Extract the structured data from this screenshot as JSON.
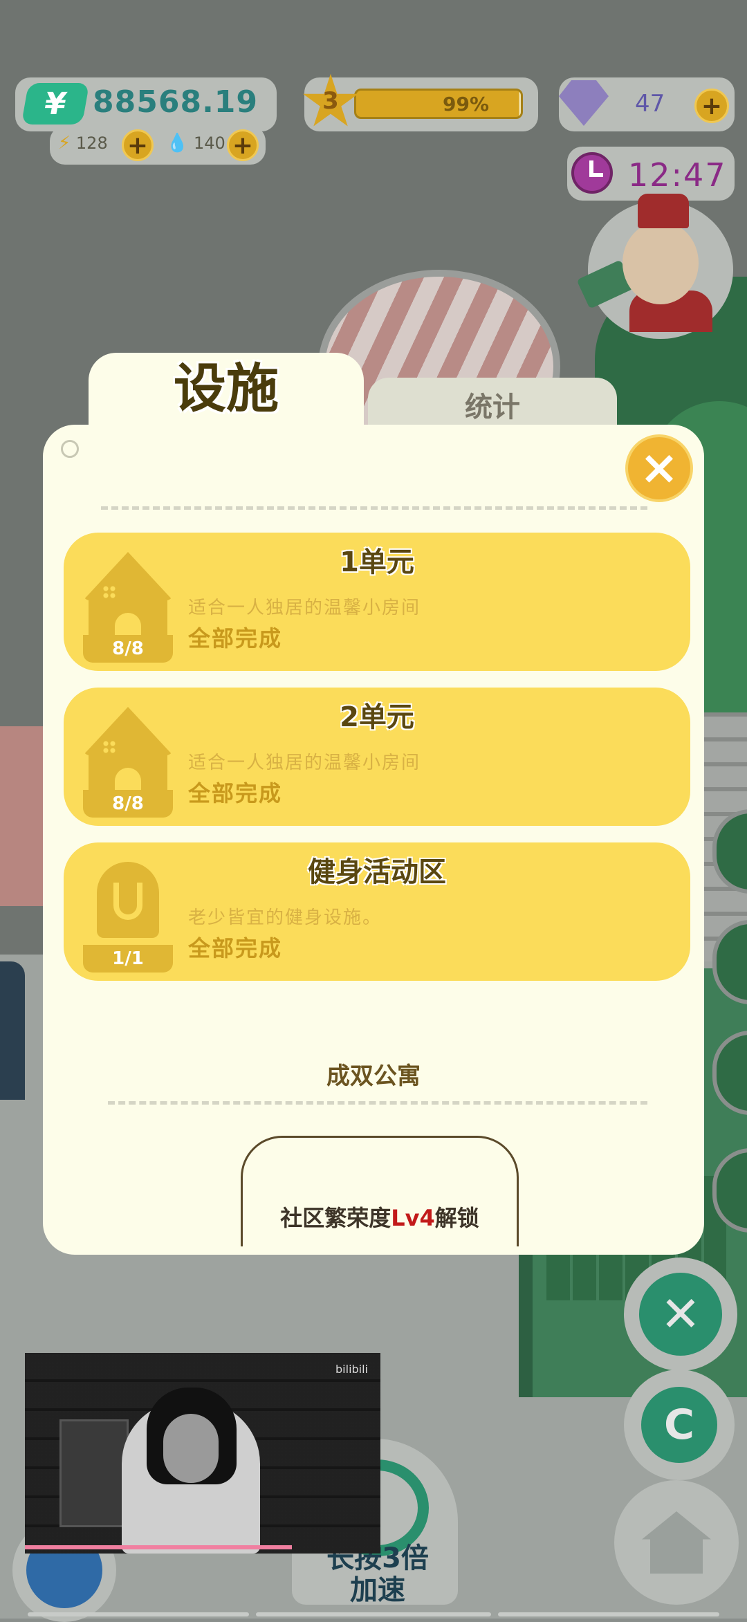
{
  "hud": {
    "money": {
      "icon": "yuan-icon",
      "symbol": "¥",
      "value": "88568.19"
    },
    "energy": {
      "icon": "lightning-icon",
      "value": "128"
    },
    "water": {
      "icon": "water-drop-icon",
      "value": "140"
    },
    "level": {
      "number": "3",
      "progress_pct": 99,
      "progress_label": "99%"
    },
    "gems": {
      "icon": "gem-icon",
      "value": "47"
    },
    "clock": {
      "icon": "clock-icon",
      "time": "12:47"
    },
    "plus_label": "+"
  },
  "dialog": {
    "tabs": [
      {
        "label": "设施",
        "active": true
      },
      {
        "label": "统计",
        "active": false
      }
    ],
    "close_label": "×",
    "facilities": [
      {
        "title": "1单元",
        "icon": "house-icon",
        "count": "8/8",
        "description": "适合一人独居的温馨小房间",
        "status": "全部完成"
      },
      {
        "title": "2单元",
        "icon": "house-icon",
        "count": "8/8",
        "description": "适合一人独居的温馨小房间",
        "status": "全部完成"
      },
      {
        "title": "健身活动区",
        "icon": "fitness-icon",
        "count": "1/1",
        "description": "老少皆宜的健身设施。",
        "status": "全部完成"
      }
    ],
    "apartment_name": "成双公寓",
    "locked": {
      "prefix": "社区繁荣度",
      "level": "Lv4",
      "suffix": "解锁"
    }
  },
  "bottom": {
    "speed_label_line1": "长按3倍",
    "speed_label_line2": "加速"
  },
  "video_overlay": {
    "logo": "bilibili"
  },
  "colors": {
    "card": "#fbdc5a",
    "panel": "#fdfde9",
    "accent_gold": "#f0b432",
    "money_green": "#2bb58a",
    "locked_highlight": "#c21a1a"
  }
}
